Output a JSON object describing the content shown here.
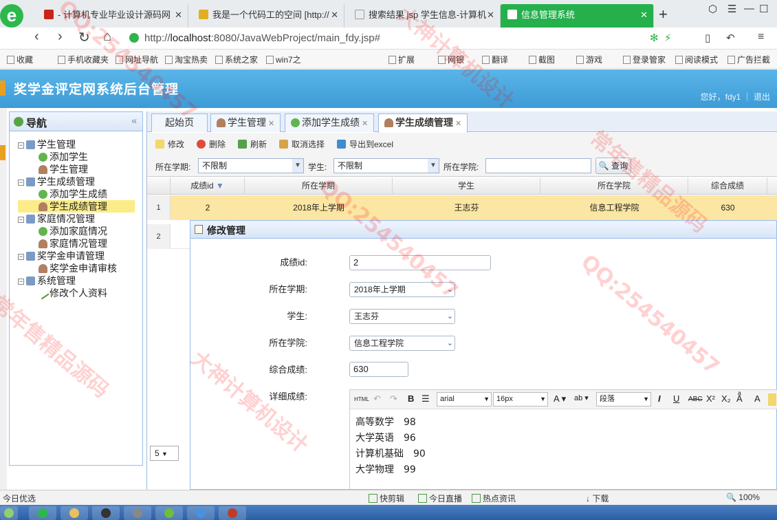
{
  "browser": {
    "tabs": [
      {
        "label": "- 计算机专业毕业设计源码网",
        "color": "#c8241a"
      },
      {
        "label": "我是一个代码工的空间 [http://",
        "color": "#e0b020"
      },
      {
        "label": "搜索结果 jsp 学生信息-计算机",
        "color": "#999999"
      },
      {
        "label": "信息管理系统",
        "color": "#ffffff"
      }
    ],
    "url_prefix": "http://",
    "url_host": "localhost",
    "url_rest": ":8080/JavaWebProject/main_fdy.jsp#",
    "bookmarks": [
      "收藏",
      "手机收藏夹",
      "网址导航",
      "淘宝热卖",
      "系统之家",
      "win7之",
      "扩展",
      "网银",
      "翻译",
      "截图",
      "游戏",
      "登录管家",
      "阅读模式",
      "广告拦截"
    ]
  },
  "app": {
    "title": "奖学金评定网系统后台管理",
    "greeting": "您好，fdy1 ｜ 退出"
  },
  "nav": {
    "title": "导航",
    "tree": [
      {
        "label": "学生管理",
        "type": "folder"
      },
      {
        "label": "添加学生",
        "type": "add"
      },
      {
        "label": "学生管理",
        "type": "user"
      },
      {
        "label": "学生成绩管理",
        "type": "folder"
      },
      {
        "label": "添加学生成绩",
        "type": "add"
      },
      {
        "label": "学生成绩管理",
        "type": "user",
        "selected": true
      },
      {
        "label": "家庭情况管理",
        "type": "folder"
      },
      {
        "label": "添加家庭情况",
        "type": "add"
      },
      {
        "label": "家庭情况管理",
        "type": "user"
      },
      {
        "label": "奖学金申请管理",
        "type": "folder"
      },
      {
        "label": "奖学金申请审核",
        "type": "user"
      },
      {
        "label": "系统管理",
        "type": "folder"
      },
      {
        "label": "修改个人资料",
        "type": "edit"
      }
    ],
    "page_size": "5"
  },
  "content_tabs": [
    "起始页",
    "学生管理",
    "添加学生成绩",
    "学生成绩管理"
  ],
  "toolbar": {
    "edit": "修改",
    "delete": "删除",
    "refresh": "刷新",
    "cancel_select": "取消选择",
    "export": "导出到excel"
  },
  "filters": {
    "term_label": "所在学期:",
    "term_value": "不限制",
    "student_label": "学生:",
    "student_value": "不限制",
    "college_label": "所在学院:",
    "college_value": "",
    "query": "查询"
  },
  "grid": {
    "columns": [
      "成绩id",
      "所在学期",
      "学生",
      "所在学院",
      "综合成绩"
    ],
    "rows": [
      {
        "num": "1",
        "id": "2",
        "term": "2018年上学期",
        "student": "王志芬",
        "college": "信息工程学院",
        "score": "630"
      },
      {
        "num": "2",
        "id": "",
        "term": "",
        "student": "",
        "college": "",
        "score": ""
      }
    ]
  },
  "dialog": {
    "title": "修改管理",
    "fields": {
      "id_label": "成绩id:",
      "id_value": "2",
      "term_label": "所在学期:",
      "term_value": "2018年上学期",
      "student_label": "学生:",
      "student_value": "王志芬",
      "college_label": "所在学院:",
      "college_value": "信息工程学院",
      "score_label": "综合成绩:",
      "score_value": "630",
      "detail_label": "详细成绩:"
    },
    "editor": {
      "html": "HTML",
      "font": "arial",
      "size": "16px",
      "para": "段落",
      "lines": [
        "高等数学　98",
        "大学英语　96",
        "计算机基础　90",
        "大学物理　99"
      ]
    }
  },
  "statusbar": [
    "今日优选",
    "快剪辑",
    "今日直播",
    "热点资讯",
    "下载",
    "100%"
  ],
  "watermarks": [
    "QQ:254540457",
    "大神计算机设计",
    "常年售精品源码"
  ]
}
